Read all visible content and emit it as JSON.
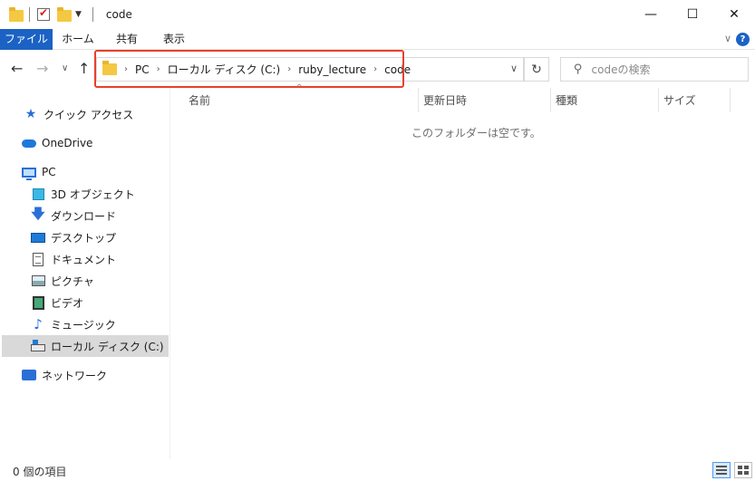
{
  "window": {
    "title": "code",
    "minimize": "—",
    "maximize": "☐",
    "close": "✕"
  },
  "ribbon": {
    "tabs": [
      "ファイル",
      "ホーム",
      "共有",
      "表示"
    ],
    "collapse": "∨",
    "help": "?"
  },
  "nav": {
    "back": "←",
    "forward": "→",
    "recent": "∨",
    "up": "↑",
    "breadcrumbs": [
      "PC",
      "ローカル ディスク (C:)",
      "ruby_lecture",
      "code"
    ],
    "separator": "›",
    "address_dropdown": "∨",
    "refresh": "↻",
    "search_placeholder": "codeの検索"
  },
  "sidebar": {
    "items": [
      {
        "label": "クイック アクセス",
        "icon": "star-icon"
      },
      {
        "label": "OneDrive",
        "icon": "cloud-icon"
      },
      {
        "label": "PC",
        "icon": "pc-icon"
      },
      {
        "label": "3D オブジェクト",
        "icon": "cube-icon"
      },
      {
        "label": "ダウンロード",
        "icon": "download-icon"
      },
      {
        "label": "デスクトップ",
        "icon": "desktop-icon"
      },
      {
        "label": "ドキュメント",
        "icon": "document-icon"
      },
      {
        "label": "ピクチャ",
        "icon": "picture-icon"
      },
      {
        "label": "ビデオ",
        "icon": "video-icon"
      },
      {
        "label": "ミュージック",
        "icon": "music-icon"
      },
      {
        "label": "ローカル ディスク (C:)",
        "icon": "drive-icon",
        "selected": true
      },
      {
        "label": "ネットワーク",
        "icon": "network-icon"
      }
    ]
  },
  "columns": {
    "name": "名前",
    "date": "更新日時",
    "type": "種類",
    "size": "サイズ",
    "sort_indicator": "^"
  },
  "main": {
    "empty_message": "このフォルダーは空です。"
  },
  "status": {
    "item_count": "0 個の項目"
  },
  "colors": {
    "file_tab": "#1b62c4",
    "highlight_border": "#e8402a",
    "selected_bg": "#d9d9d9"
  }
}
